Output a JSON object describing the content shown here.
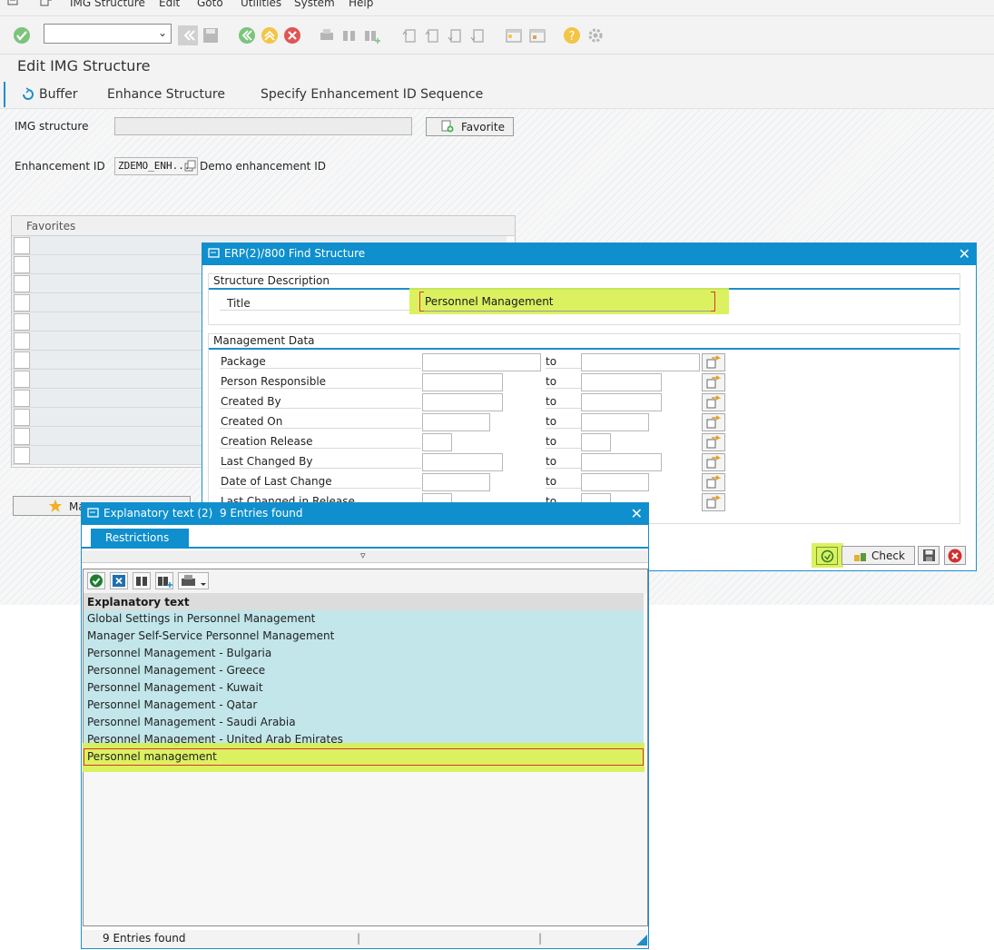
{
  "menu": {
    "items": [
      "IMG Structure",
      "Edit",
      "Goto",
      "Utilities",
      "System",
      "Help"
    ]
  },
  "toolbar": {
    "command_value": ""
  },
  "page": {
    "title": "Edit IMG Structure"
  },
  "appbar": {
    "buffer": "Buffer",
    "enhance": "Enhance Structure",
    "specify": "Specify Enhancement ID Sequence"
  },
  "form": {
    "img_structure_label": "IMG structure",
    "img_structure_value": "",
    "favorite_button": "Favorite",
    "enhancement_label": "Enhancement ID",
    "enhancement_value": "ZDEMO_ENH...",
    "enhancement_desc": "Demo enhancement ID"
  },
  "favorites": {
    "header": "Favorites",
    "button": "Ma"
  },
  "find_dialog": {
    "title": "ERP(2)/800 Find Structure",
    "structure_group": "Structure Description",
    "title_label": "Title",
    "title_value": "Personnel Management",
    "mgmt_group": "Management Data",
    "to": "to",
    "rows": [
      "Package",
      "Person Responsible",
      "Created By",
      "Created On",
      "Creation Release",
      "Last Changed By",
      "Date of Last Change",
      "Last Changed in Release"
    ],
    "check_button": "Check"
  },
  "expl_dialog": {
    "title": "Explanatory text (2)",
    "entries_found": "9 Entries found",
    "tab": "Restrictions",
    "column_header": "Explanatory text",
    "items": [
      "Global Settings in Personnel Management",
      "Manager Self-Service Personnel Management",
      "Personnel Management - Bulgaria",
      "Personnel Management - Greece",
      "Personnel Management - Kuwait",
      "Personnel Management - Qatar",
      "Personnel Management - Saudi Arabia",
      "Personnel Management - United Arab Emirates",
      "Personnel management"
    ],
    "status": "9 Entries found"
  }
}
